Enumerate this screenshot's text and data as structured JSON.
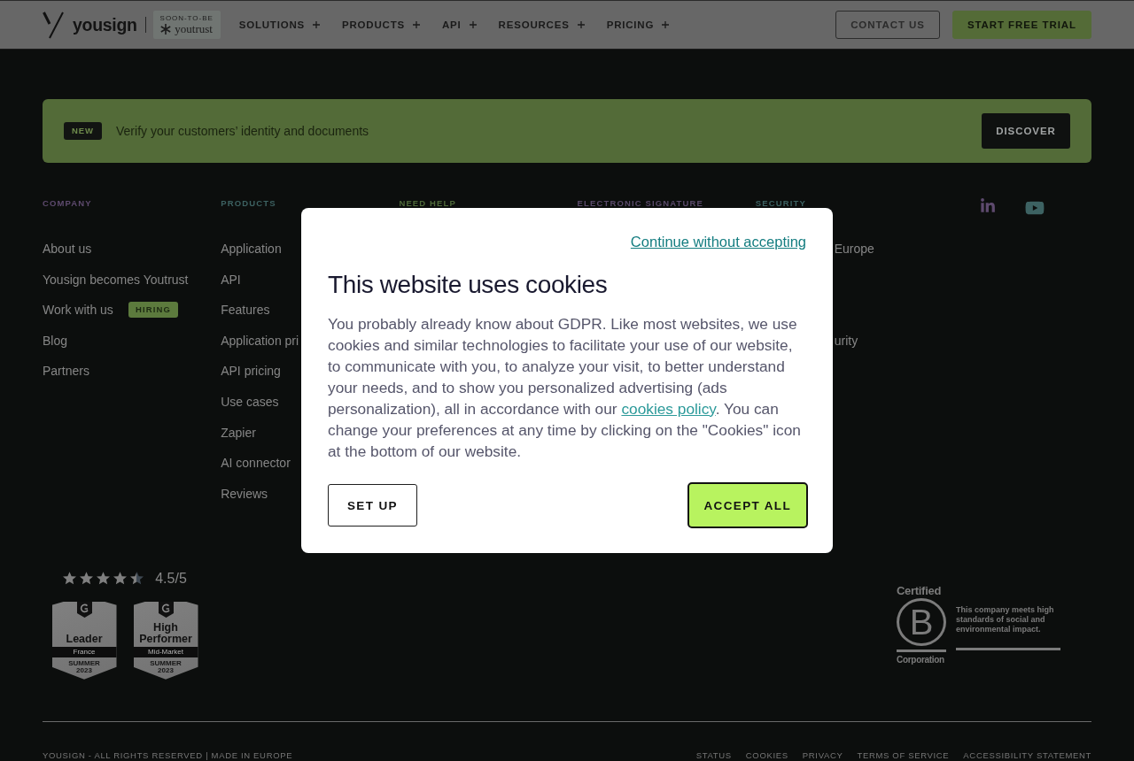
{
  "header": {
    "logo": "yousign",
    "rebrand_badge": {
      "caption": "SOON-TO-BE",
      "name": "youtrust"
    },
    "nav": [
      "SOLUTIONS",
      "PRODUCTS",
      "API",
      "RESOURCES",
      "PRICING"
    ],
    "buttons": [
      {
        "label": "CONTACT US",
        "kind": "outline"
      },
      {
        "label": "START FREE TRIAL",
        "kind": "primary"
      }
    ]
  },
  "banner": {
    "tag": "NEW",
    "text": "Verify your customers’ identity and documents",
    "button": "DISCOVER"
  },
  "footer_columns": [
    {
      "heading": "COMPANY",
      "color": "#5e4a6e",
      "items": [
        {
          "label": "About us"
        },
        {
          "label": "Yousign becomes Youtrust"
        },
        {
          "label": "Work with us",
          "tag": "HIRING"
        },
        {
          "label": "Blog"
        },
        {
          "label": "Partners"
        }
      ]
    },
    {
      "heading": "PRODUCTS",
      "color": "#3d6262",
      "items": [
        {
          "label": "Application"
        },
        {
          "label": "API"
        },
        {
          "label": "Features"
        },
        {
          "label": "Application pri"
        },
        {
          "label": "API pricing"
        },
        {
          "label": "Use cases"
        },
        {
          "label": "Zapier"
        },
        {
          "label": "AI connector"
        },
        {
          "label": "Reviews"
        }
      ]
    },
    {
      "heading": "NEED HELP",
      "color": "#4f6a3a"
    },
    {
      "heading": "ELECTRONIC SIGNATURE",
      "color": "#5a4a6a"
    },
    {
      "heading": "SECURITY",
      "color": "#3d6262",
      "items": [
        {
          "label": "Europe"
        },
        {
          "label": "urity"
        }
      ]
    }
  ],
  "rating": {
    "stars": 4.5,
    "score": "4.5/5"
  },
  "awards": [
    {
      "title": "Leader",
      "segment": "France",
      "season": "SUMMER",
      "year": "2023"
    },
    {
      "title": "High Performer",
      "segment": "Mid-Market",
      "season": "SUMMER",
      "year": "2023"
    }
  ],
  "certification": {
    "top": "Certified",
    "mark": "B",
    "bottom": "Corporation",
    "statement": "This company meets high standards of social and environmental impact."
  },
  "legal": {
    "copyright": "YOUSIGN - ALL RIGHTS RESERVED | MADE IN EUROPE",
    "links": [
      "STATUS",
      "COOKIES",
      "PRIVACY",
      "TERMS OF SERVICE",
      "ACCESSIBILITY STATEMENT"
    ]
  },
  "cookie_dialog": {
    "skip_link": "Continue without accepting",
    "title": "This website uses cookies",
    "text_before": "You probably already know about GDPR. Like most websites, we use cookies and similar technologies to facilitate your use of our website, to communicate with you, to analyze your visit, to better understand your needs, and to show you personalized advertising (ads personalization), all in accordance with our ",
    "policy_link": "cookies policy",
    "text_after": ". You can change your preferences at any time by clicking on the \"Cookies\" icon at the bottom of our website.",
    "buttons": [
      {
        "label": "SET UP",
        "kind": "outline"
      },
      {
        "label": "ACCEPT ALL",
        "kind": "primary"
      }
    ]
  }
}
